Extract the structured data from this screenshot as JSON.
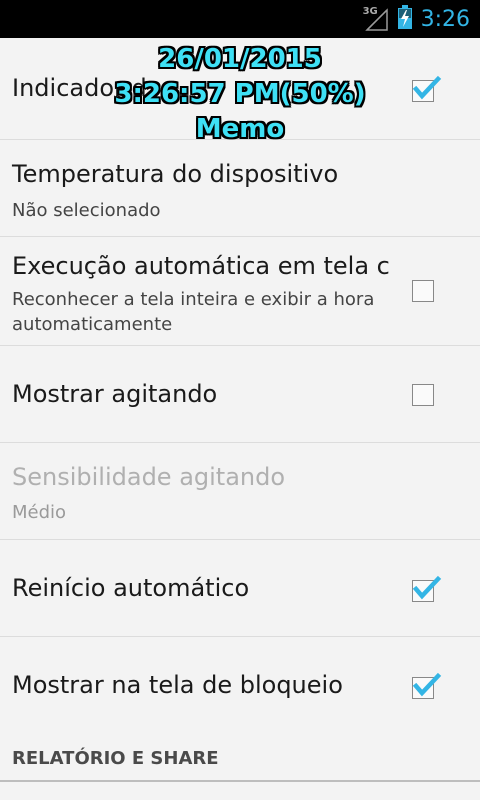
{
  "status_bar": {
    "network": "3G",
    "time": "3:26",
    "icons": [
      "signal-icon",
      "battery-charging-icon"
    ]
  },
  "overlay": {
    "date": "26/01/2015",
    "time_battery": "3:26:57 PM(50%)",
    "memo": "Memo"
  },
  "settings": [
    {
      "title": "Indicador d",
      "checked": true
    },
    {
      "title": "Temperatura do dispositivo",
      "summary": "Não selecionado"
    },
    {
      "title": "Execução automática em tela c",
      "summary": "Reconhecer a tela inteira e exibir a hora automaticamente",
      "checked": false
    },
    {
      "title": "Mostrar agitando",
      "checked": false
    },
    {
      "title": "Sensibilidade agitando",
      "summary": "Médio",
      "enabled": false
    },
    {
      "title": "Reinício automático",
      "checked": true
    },
    {
      "title": "Mostrar na tela de bloqueio",
      "checked": true
    }
  ],
  "section_header": "RELATÓRIO E SHARE",
  "colors": {
    "accent": "#33b5e5",
    "overlay_text": "#3ee0f5"
  }
}
